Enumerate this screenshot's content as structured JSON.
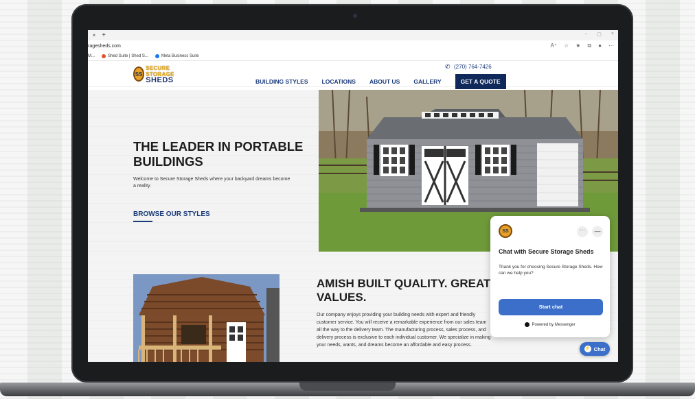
{
  "browser": {
    "tab_close": "×",
    "tab_new": "+",
    "window_controls": [
      "–",
      "▢",
      "×"
    ],
    "url": "ragesheds.com",
    "address_icons": [
      "A⁺",
      "☆",
      "★",
      "⧉",
      "●",
      "⋯"
    ],
    "bookmarks": [
      {
        "label": "M...",
        "color": ""
      },
      {
        "label": "Shed Suite | Shed S...",
        "color": "#e0532b"
      },
      {
        "label": "Meta Business Suite",
        "color": "#1877f2"
      }
    ]
  },
  "site": {
    "logo": {
      "badge": "SS",
      "line1": "SECURE STORAGE",
      "line2": "SHEDS"
    },
    "phone": "(270) 764-7426",
    "nav": [
      "BUILDING STYLES",
      "LOCATIONS",
      "ABOUT US",
      "GALLERY"
    ],
    "cta": "GET A QUOTE",
    "hero": {
      "title": "THE LEADER IN PORTABLE BUILDINGS",
      "subtitle": "Welcome to Secure Storage Sheds where your backyard dreams become a reality.",
      "link": "BROWSE OUR STYLES"
    },
    "section2": {
      "title": "AMISH BUILT QUALITY. GREAT VALUES.",
      "body": "Our company enjoys providing your building needs with expert and friendly customer service. You will receive a remarkable experience from our sales team all the way to the delivery team. The manufacturing process, sales process, and delivery process is exclusive to each individual customer. We specialize in making your needs, wants, and dreams become an affordable and easy process."
    }
  },
  "chat": {
    "title": "Chat with Secure Storage Sheds",
    "message": "Thank you for choosing Secure Storage Sheds. How can we help you?",
    "start": "Start chat",
    "powered": "Powered by Messenger",
    "more": "···",
    "minimize": "—",
    "fab": "Chat"
  },
  "colors": {
    "navy": "#0f2a5a",
    "brand_blue": "#1b3a7a",
    "messenger_blue": "#3b6fc9",
    "logo_gold": "#e8a025"
  }
}
